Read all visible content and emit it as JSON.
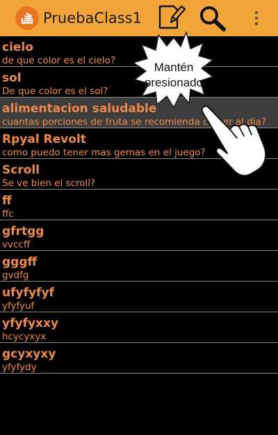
{
  "app": {
    "title": "PruebaClass1"
  },
  "tooltip": {
    "line1": "Mantén",
    "line2": "presionado"
  },
  "list": [
    {
      "title": "cielo",
      "subtitle": "de que color es el cielo?"
    },
    {
      "title": "sol",
      "subtitle": "De que color es el sol?"
    },
    {
      "title": "alimentacion saludable",
      "subtitle": "cuantas porciones de fruta se recomienda comer al dia?"
    },
    {
      "title": "Rpyal Revolt",
      "subtitle": "como puedo tener mas gemas en el juego?"
    },
    {
      "title": "Scroll",
      "subtitle": "Se ve bien el scroll?"
    },
    {
      "title": "ff",
      "subtitle": "ffc"
    },
    {
      "title": "gfrtgg",
      "subtitle": "vvccff"
    },
    {
      "title": "gggff",
      "subtitle": "gvdfg"
    },
    {
      "title": "ufyfyfyf",
      "subtitle": "yfyfyuf"
    },
    {
      "title": "yfyfyxxy",
      "subtitle": "hcycyxyx"
    },
    {
      "title": "gcyxyxy",
      "subtitle": "yfyfydy"
    }
  ]
}
